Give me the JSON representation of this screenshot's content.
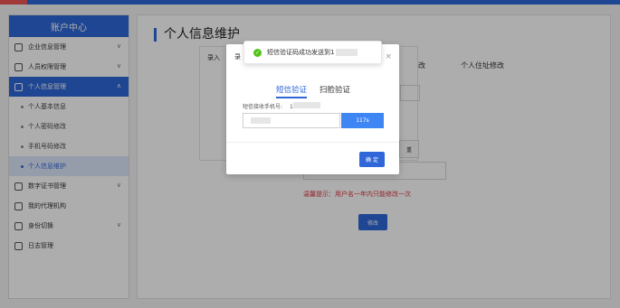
{
  "sidebar": {
    "title": "账户中心",
    "items": [
      {
        "label": "企业信息管理",
        "icon": "building-icon"
      },
      {
        "label": "人员权限管理",
        "icon": "user-lock-icon"
      },
      {
        "label": "个人信息管理",
        "icon": "profile-icon"
      }
    ],
    "subitems": [
      {
        "label": "个人基本信息"
      },
      {
        "label": "个人密码修改"
      },
      {
        "label": "手机号码修改"
      },
      {
        "label": "个人信息维护"
      }
    ],
    "items_after": [
      {
        "label": "数字证书管理",
        "icon": "certificate-icon"
      },
      {
        "label": "我的代理机构",
        "icon": "agency-icon"
      },
      {
        "label": "身份切换",
        "icon": "switch-icon"
      },
      {
        "label": "日志管理",
        "icon": "log-icon"
      }
    ]
  },
  "main": {
    "title": "个人信息维护",
    "tab_right_1": "改",
    "tab_right_2": "个人住址修改",
    "inner_tab": "录入",
    "small_button": "重",
    "tip": "温馨提示：用户名一年内只能修改一次",
    "modify_button": "修改"
  },
  "modal": {
    "title_fragment": "录",
    "tabs": [
      "短信验证",
      "扫脸验证"
    ],
    "phone_label": "短信接收手机号:",
    "phone_prefix": "1",
    "countdown": "117s",
    "confirm": "确 定"
  },
  "toast": {
    "message": "短信验证码成功发送到1"
  },
  "colors": {
    "primary": "#2f67d8",
    "success": "#52c41a",
    "tip": "#d9363e"
  }
}
